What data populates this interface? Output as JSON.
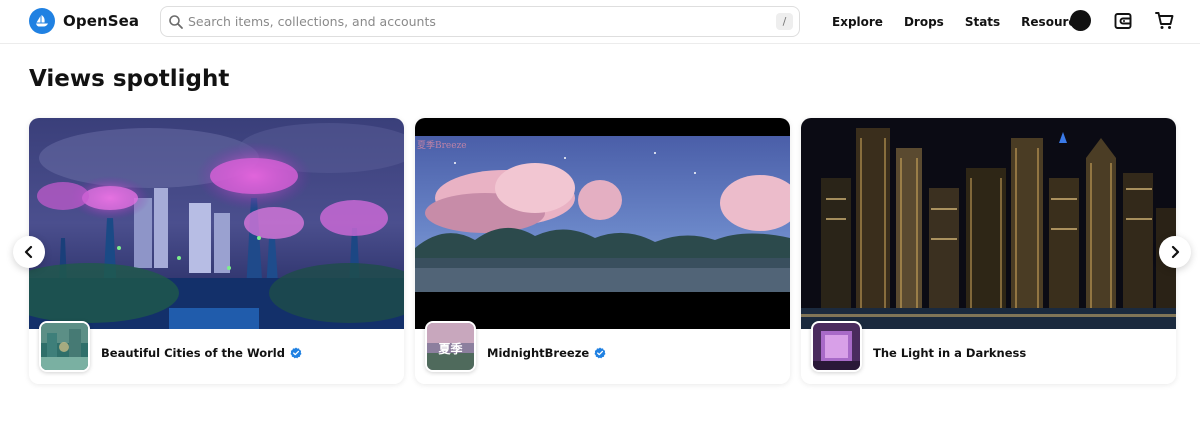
{
  "nav": {
    "logo_text": "OpenSea",
    "search_placeholder": "Search items, collections, and accounts",
    "search_shortcut": "/",
    "links": [
      "Explore",
      "Drops",
      "Stats",
      "Resources"
    ]
  },
  "section": {
    "title": "Views spotlight"
  },
  "cards": [
    {
      "name": "Beautiful Cities of the World",
      "verified": true
    },
    {
      "name": "MidnightBreeze",
      "verified": true
    },
    {
      "name": "The Light in a Darkness",
      "verified": false
    }
  ],
  "colors": {
    "brand_blue": "#2081e2",
    "verified_blue": "#2081e2"
  },
  "icons": [
    "search-icon",
    "wallet-icon",
    "cart-icon",
    "verified-icon",
    "chevron-left-icon",
    "chevron-right-icon"
  ]
}
